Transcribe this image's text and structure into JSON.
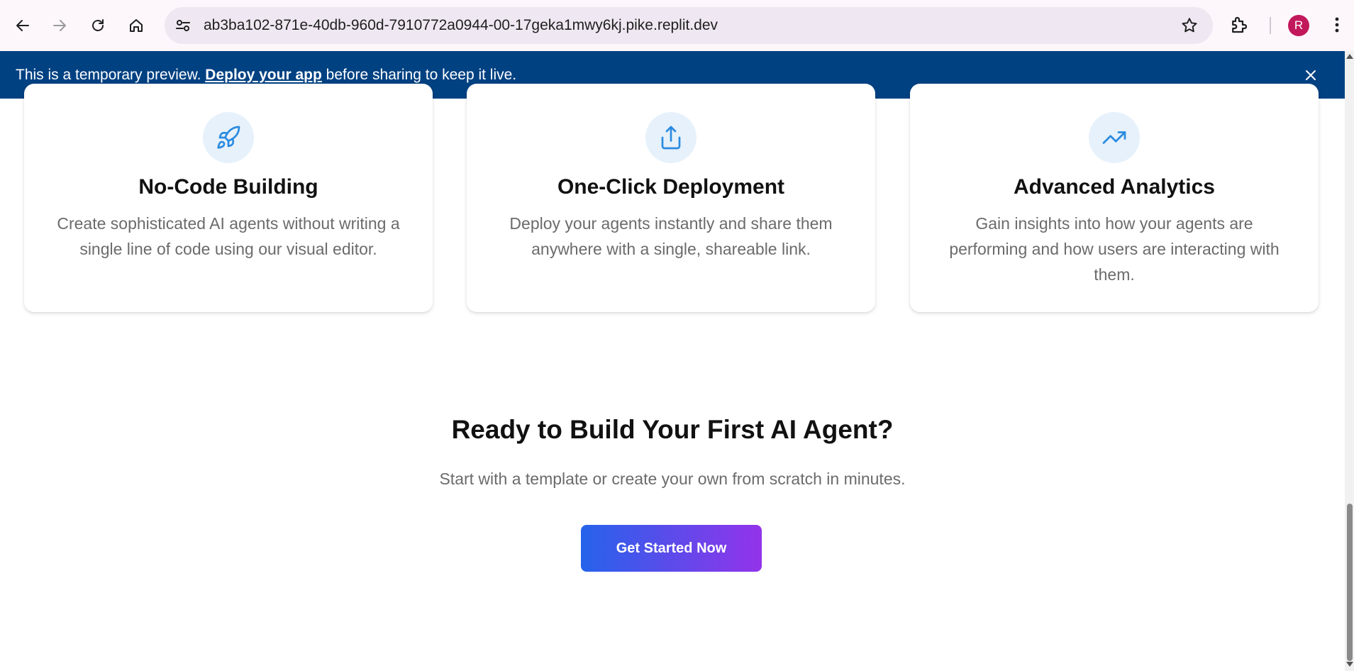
{
  "browser": {
    "url": "ab3ba102-871e-40db-960d-7910772a0944-00-17geka1mwy6kj.pike.replit.dev",
    "avatar_letter": "R",
    "icons": {
      "back": "arrow-left-icon",
      "forward": "arrow-right-icon",
      "reload": "reload-icon",
      "home": "home-icon",
      "site_info": "tune-icon",
      "bookmark": "star-icon",
      "extensions": "puzzle-icon",
      "menu": "kebab-icon"
    }
  },
  "banner": {
    "prefix": "This is a temporary preview.",
    "link": "Deploy your app",
    "suffix": "before sharing to keep it live.",
    "background": "#004182"
  },
  "features": [
    {
      "icon": "rocket-icon",
      "title": "No-Code Building",
      "description": "Create sophisticated AI agents without writing a single line of code using our visual editor."
    },
    {
      "icon": "share-icon",
      "title": "One-Click Deployment",
      "description": "Deploy your agents instantly and share them anywhere with a single, shareable link."
    },
    {
      "icon": "trending-up-icon",
      "title": "Advanced Analytics",
      "description": "Gain insights into how your agents are performing and how users are interacting with them."
    }
  ],
  "cta": {
    "title": "Ready to Build Your First AI Agent?",
    "subtitle": "Start with a template or create your own from scratch in minutes.",
    "button_label": "Get Started Now",
    "gradient_start": "#2563eb",
    "gradient_end": "#9333ea"
  },
  "colors": {
    "icon_accent": "#2b8be0",
    "icon_circle_bg": "#e6f1fb",
    "muted_text": "#6b6b6b"
  }
}
